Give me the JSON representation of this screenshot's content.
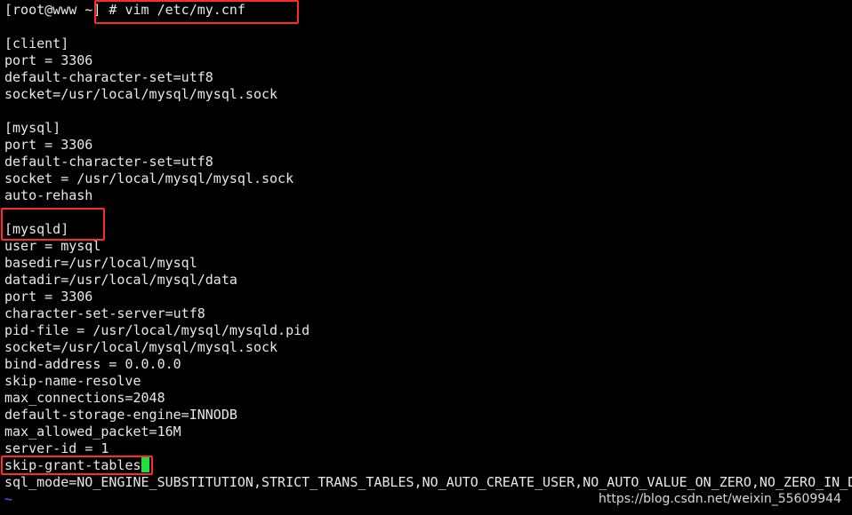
{
  "terminal": {
    "prompt": "[root@www ~]",
    "command": "# vim /etc/my.cnf",
    "client": {
      "header": "[client]",
      "lines": [
        "port = 3306",
        "default-character-set=utf8",
        "socket=/usr/local/mysql/mysql.sock"
      ]
    },
    "mysql": {
      "header": "[mysql]",
      "lines": [
        "port = 3306",
        "default-character-set=utf8",
        "socket = /usr/local/mysql/mysql.sock",
        "auto-rehash"
      ]
    },
    "mysqld": {
      "header": "[mysqld]",
      "lines": [
        "user = mysql",
        "basedir=/usr/local/mysql",
        "datadir=/usr/local/mysql/data",
        "port = 3306",
        "character-set-server=utf8",
        "pid-file = /usr/local/mysql/mysqld.pid",
        "socket=/usr/local/mysql/mysql.sock",
        "bind-address = 0.0.0.0",
        "skip-name-resolve",
        "max_connections=2048",
        "default-storage-engine=INNODB",
        "max_allowed_packet=16M",
        "server-id = 1"
      ],
      "skip_grant": "skip-grant-tables",
      "sql_mode": "sql_mode=NO_ENGINE_SUBSTITUTION,STRICT_TRANS_TABLES,NO_AUTO_CREATE_USER,NO_AUTO_VALUE_ON_ZERO,NO_ZERO_IN_D"
    },
    "empty_line_marker": "~"
  },
  "watermark": "https://blog.csdn.net/weixin_55609944",
  "colors": {
    "background": "#000000",
    "text": "#e8e8e8",
    "cursor": "#22e03a",
    "highlight": "#ff2a2a",
    "tilde": "#4a6cff"
  }
}
